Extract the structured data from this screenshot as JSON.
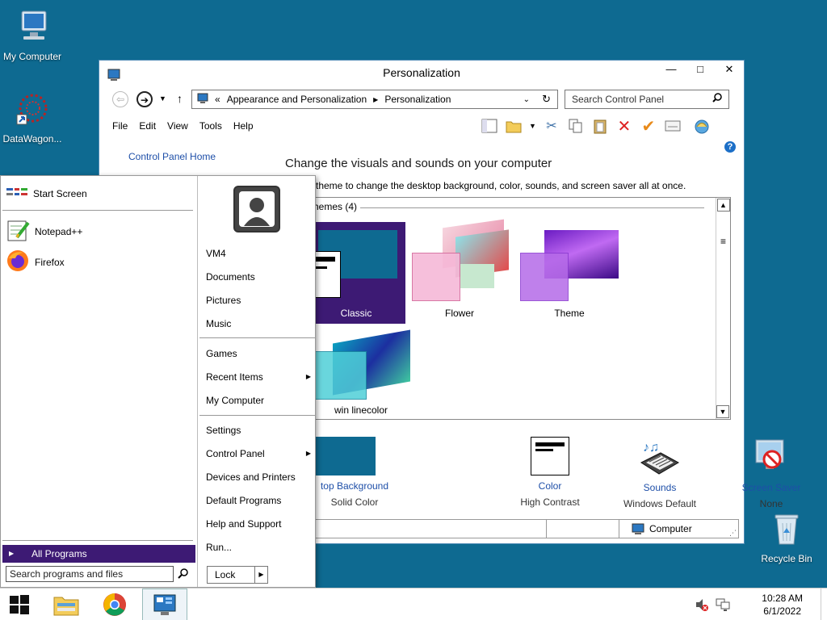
{
  "desktop": {
    "icons": [
      {
        "label": "My Computer"
      },
      {
        "label": "DataWagon..."
      },
      {
        "label": "Recycle Bin"
      }
    ]
  },
  "window": {
    "title": "Personalization",
    "controls": {
      "minimize": "—",
      "maximize": "□",
      "close": "✕"
    },
    "address": {
      "chevrons": "«",
      "crumb1": "Appearance and Personalization",
      "crumb2": "Personalization"
    },
    "search_placeholder": "Search Control Panel",
    "menu": [
      "File",
      "Edit",
      "View",
      "Tools",
      "Help"
    ],
    "cp_home": "Control Panel Home",
    "heading": "Change the visuals and sounds on your computer",
    "subtext": "theme to change the desktop background, color, sounds, and screen saver all at once.",
    "group_label": "hemes (4)",
    "themes": [
      {
        "label": "Classic"
      },
      {
        "label": "Flower"
      },
      {
        "label": "Theme"
      },
      {
        "label": "win linecolor"
      }
    ],
    "settings": [
      {
        "title": "top Background",
        "value": "Solid Color"
      },
      {
        "title": "Color",
        "value": "High Contrast"
      },
      {
        "title": "Sounds",
        "value": "Windows Default"
      },
      {
        "title": "Screen Saver",
        "value": "None"
      }
    ],
    "status_computer": "Computer"
  },
  "start_menu": {
    "left_items": [
      {
        "label": "Start Screen"
      },
      {
        "label": "Notepad++"
      },
      {
        "label": "Firefox"
      }
    ],
    "all_programs": "All Programs",
    "search_placeholder": "Search programs and files",
    "right_items": [
      {
        "label": "VM4"
      },
      {
        "label": "Documents"
      },
      {
        "label": "Pictures"
      },
      {
        "label": "Music"
      },
      {
        "label": "Games"
      },
      {
        "label": "Recent Items"
      },
      {
        "label": "My Computer"
      },
      {
        "label": "Settings"
      },
      {
        "label": "Control Panel"
      },
      {
        "label": "Devices and Printers"
      },
      {
        "label": "Default Programs"
      },
      {
        "label": "Help and Support"
      },
      {
        "label": "Run..."
      }
    ],
    "lock": "Lock"
  },
  "taskbar": {
    "time": "10:28 AM",
    "date": "6/1/2022"
  },
  "colors": {
    "desktop": "#0e6a91",
    "accent_purple": "#3d1a74"
  }
}
